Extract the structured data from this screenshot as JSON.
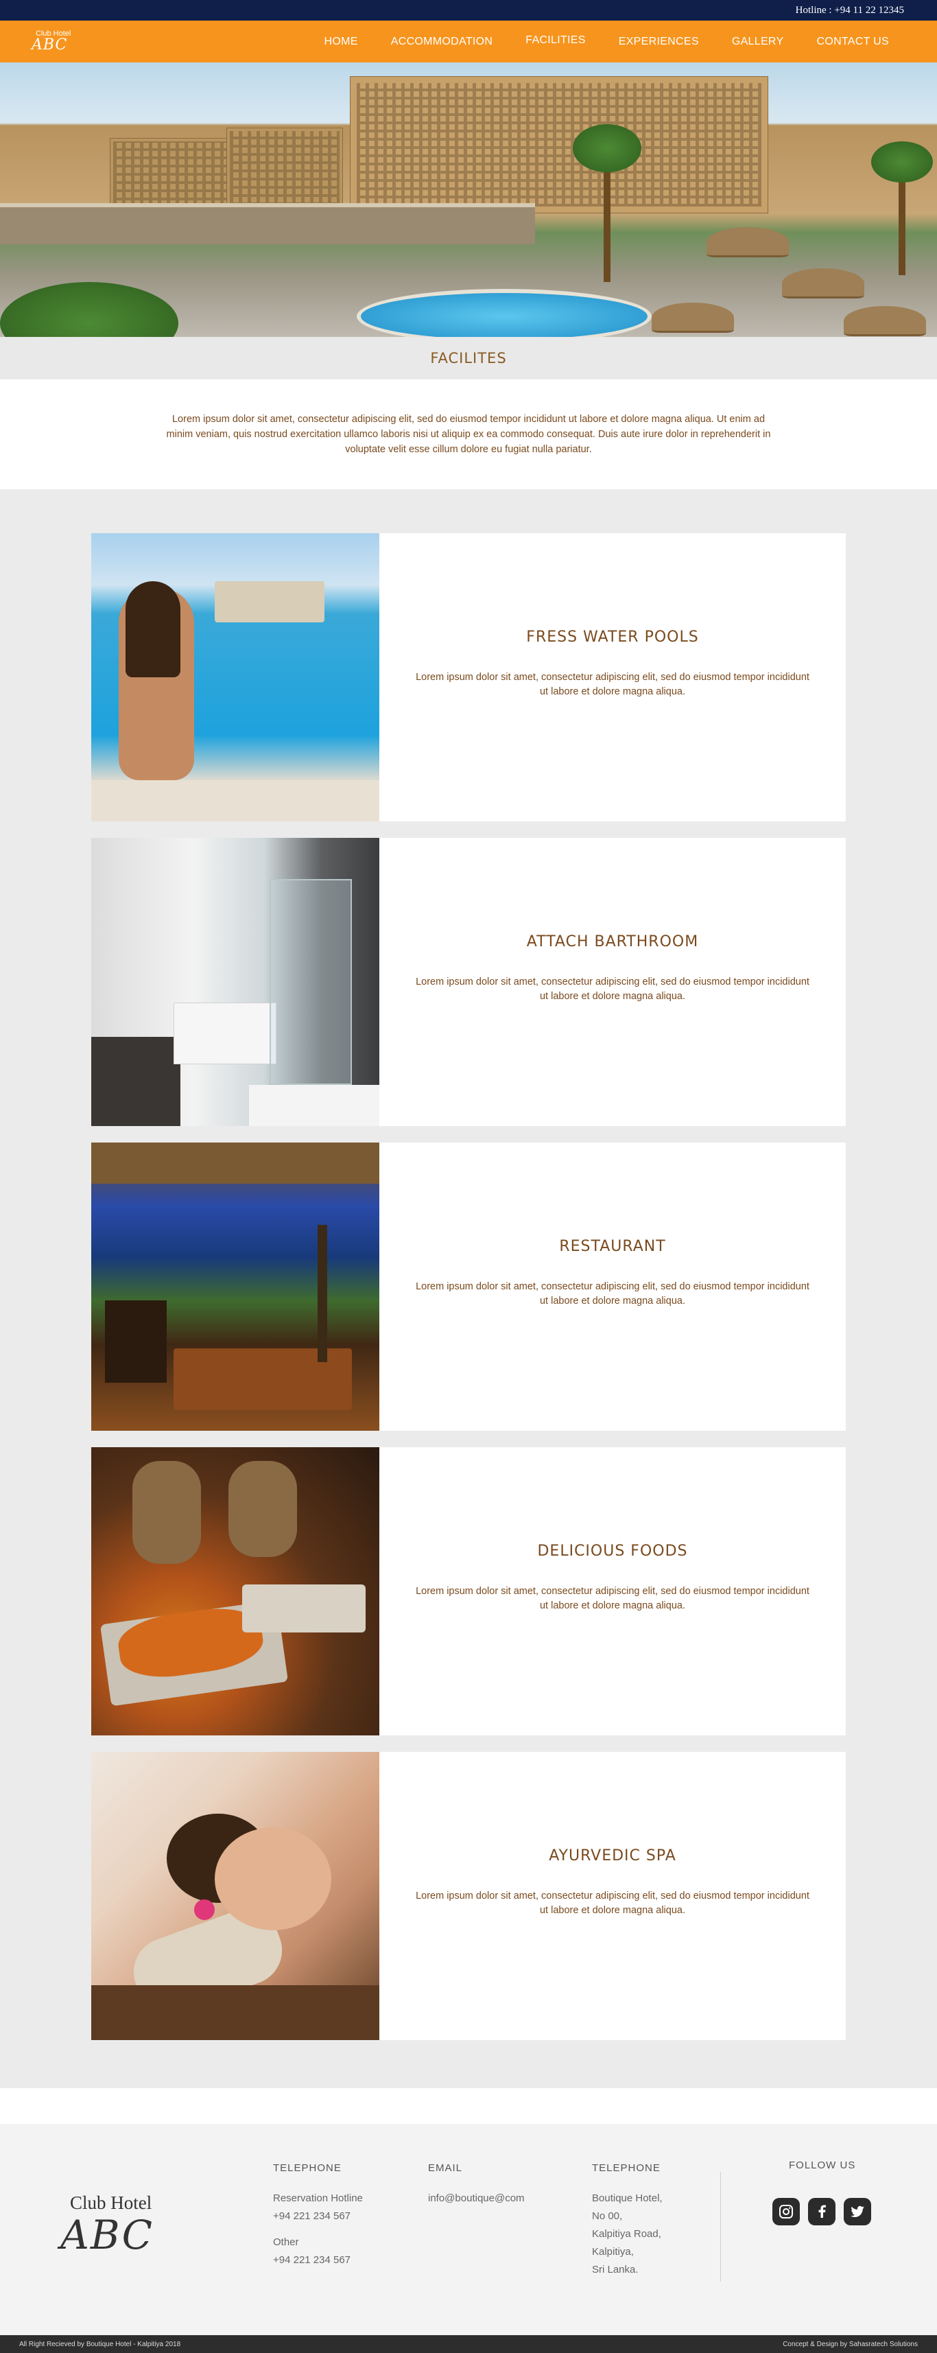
{
  "topbar": {
    "hotline": "Hotline : +94 11 22 12345"
  },
  "nav": {
    "logo_line1": "Club Hotel",
    "logo_line2": "ABC",
    "items": [
      {
        "label": "HOME"
      },
      {
        "label": "ACCOMMODATION"
      },
      {
        "label": "FACILITIES",
        "active": true
      },
      {
        "label": "EXPERIENCES"
      },
      {
        "label": "GALLERY"
      },
      {
        "label": "CONTACT US"
      }
    ]
  },
  "page": {
    "title": "FACILITES",
    "intro": "Lorem ipsum dolor sit amet, consectetur adipiscing elit, sed do eiusmod tempor incididunt ut labore et dolore magna aliqua. Ut enim ad minim veniam, quis nostrud exercitation ullamco laboris nisi ut aliquip ex ea commodo consequat. Duis aute irure dolor in reprehenderit in voluptate velit esse cillum dolore eu fugiat nulla pariatur."
  },
  "features": [
    {
      "title": "FRESS WATER POOLS",
      "text": "Lorem ipsum dolor sit amet, consectetur adipiscing elit, sed do eiusmod tempor incididunt ut labore et dolore magna aliqua.",
      "icon": "pool-photo"
    },
    {
      "title": "ATTACH BARTHROOM",
      "text": "Lorem ipsum dolor sit amet, consectetur adipiscing elit, sed do eiusmod tempor incididunt ut labore et dolore magna aliqua.",
      "icon": "bathroom-photo"
    },
    {
      "title": "RESTAURANT",
      "text": "Lorem ipsum dolor sit amet, consectetur adipiscing elit, sed do eiusmod tempor incididunt ut labore et dolore magna aliqua.",
      "icon": "restaurant-photo"
    },
    {
      "title": "DELICIOUS FOODS",
      "text": "Lorem ipsum dolor sit amet, consectetur adipiscing elit, sed do eiusmod tempor incididunt ut labore et dolore magna aliqua.",
      "icon": "food-photo"
    },
    {
      "title": "AYURVEDIC SPA",
      "text": "Lorem ipsum dolor sit amet, consectetur adipiscing elit, sed do eiusmod tempor incididunt ut labore et dolore magna aliqua.",
      "icon": "spa-photo"
    }
  ],
  "footer": {
    "logo_line1": "Club Hotel",
    "logo_line2": "ABC",
    "telephone": {
      "heading": "TELEPHONE",
      "reservation_label": "Reservation Hotline",
      "reservation_number": "+94 221 234 567",
      "other_label": "Other",
      "other_number": "+94 221 234 567"
    },
    "email": {
      "heading": "EMAIL",
      "address": "info@boutique@com"
    },
    "address": {
      "heading": "TELEPHONE",
      "lines": [
        "Boutique Hotel,",
        "No 00,",
        "Kalpitiya Road,",
        "Kalpitiya,",
        "Sri Lanka."
      ]
    },
    "follow": {
      "heading": "FOLLOW US",
      "icons": [
        "instagram-icon",
        "facebook-icon",
        "twitter-icon"
      ]
    },
    "copyright": "All Right Recieved by Boutique Hotel - Kalpitiya 2018",
    "credit": "Concept & Design by Sahasratech Solutions"
  },
  "colors": {
    "topbar": "#0f1f4a",
    "nav": "#f7941d",
    "accent_text": "#7a4a1e",
    "features_bg": "#ebebeb"
  }
}
